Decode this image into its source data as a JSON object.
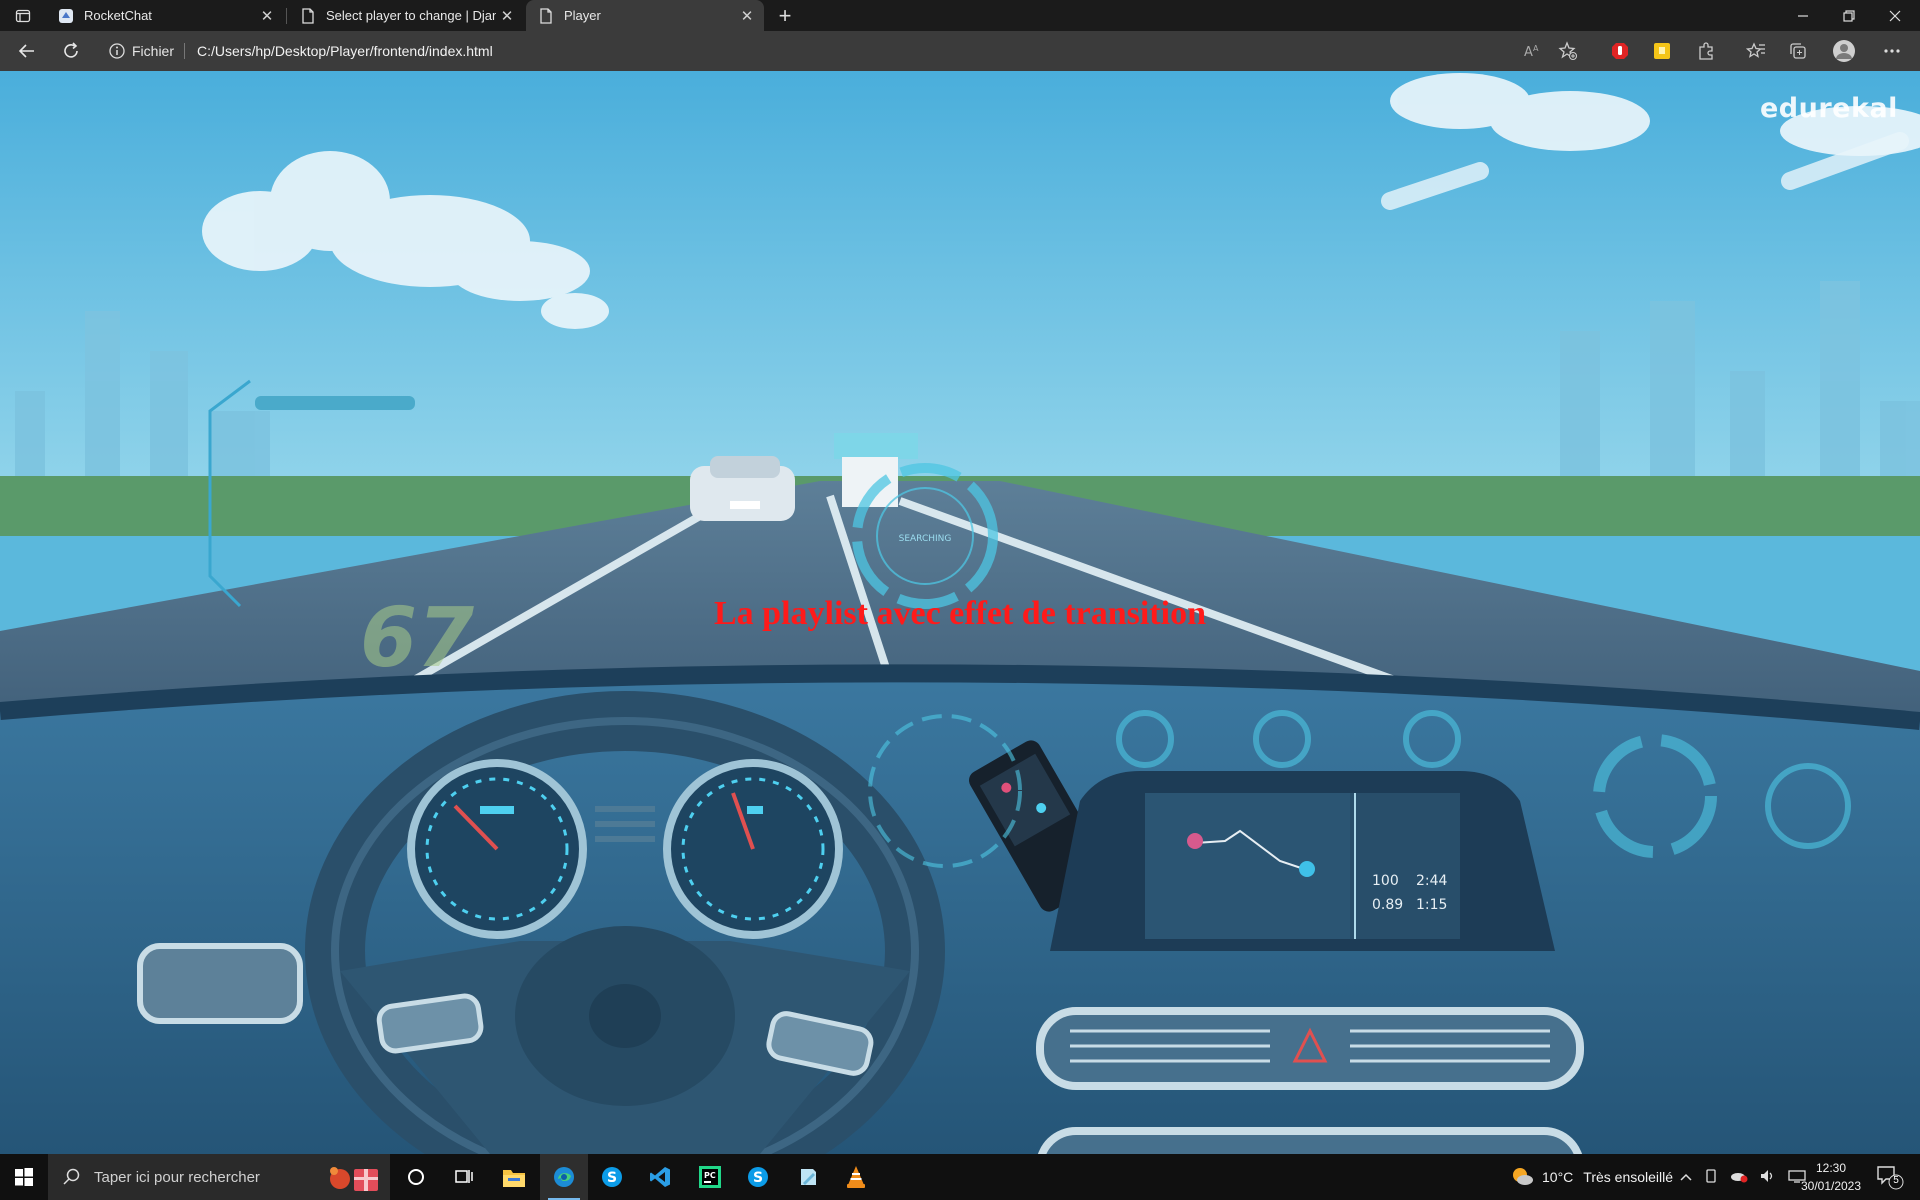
{
  "browser": {
    "tabs": [
      {
        "title": "RocketChat",
        "icon": "rocketchat-icon",
        "active": false
      },
      {
        "title": "Select player to change | Django",
        "icon": "page-icon",
        "active": false
      },
      {
        "title": "Player",
        "icon": "page-icon",
        "active": true
      }
    ],
    "address": {
      "scheme_label": "Fichier",
      "url": "C:/Users/hp/Desktop/Player/frontend/index.html"
    },
    "toolbar_icons": [
      "read-aloud-icon",
      "add-favorite-icon",
      "adblock-icon",
      "extension-yellow-icon",
      "extensions-icon",
      "favorites-icon",
      "collections-icon",
      "profile-icon",
      "more-icon"
    ]
  },
  "page": {
    "heading": "La playlist avec effet de transition",
    "video": {
      "watermark": "edurekal",
      "dashboard_readout": {
        "row1": [
          "100",
          "2:44"
        ],
        "row2": [
          "0.89",
          "1:15"
        ]
      },
      "speed_overlay": "67",
      "radar_text": "SEARCHING"
    }
  },
  "taskbar": {
    "search_placeholder": "Taper ici pour rechercher",
    "apps": [
      "cortana-icon",
      "task-view-icon",
      "file-explorer-icon",
      "edge-icon",
      "skype-icon",
      "vscode-icon",
      "pycharm-icon",
      "skype-icon-2",
      "notepad-icon",
      "vlc-icon"
    ],
    "weather": {
      "temp": "10°C",
      "condition": "Très ensoleillé"
    },
    "time": "12:30",
    "date": "30/01/2023",
    "notification_count": "5"
  },
  "colors": {
    "heading": "#ff1a1a",
    "sky": "#5bb8dc",
    "taskbar": "#101010",
    "chrome_dark": "#1b1b1b",
    "chrome_mid": "#3b3b3b"
  }
}
